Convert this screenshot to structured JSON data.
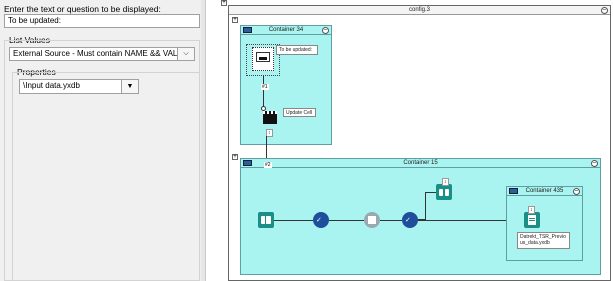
{
  "properties_panel": {
    "question_label": "Enter the text or question to be displayed:",
    "question_value": "To be updated:",
    "list_values_label": "List Values",
    "list_source_value": "External Source - Must contain NAME && VALUE",
    "properties_label": "Properties",
    "file_value": "\\Input data.yxdb"
  },
  "canvas": {
    "outer_container_title": "config.3",
    "container_34": {
      "title": "Container 34",
      "note_question": "To be updated:",
      "connection_label": "#1",
      "note_update": "Update Cell"
    },
    "container_15": {
      "title": "Container 15",
      "connection_label": "#2"
    },
    "container_435": {
      "title": "Container 435",
      "output_note": "Datrekt_TSR_Previous_data.yxdb"
    }
  },
  "colors": {
    "container_fill": "#a9f4f0",
    "tool_blue": "#1f4e9c",
    "tool_teal": "#1a8f86",
    "tool_grey": "#9aa8b0"
  },
  "icons": [
    "chevron-down-icon",
    "container-icon",
    "collapse-icon",
    "book-input-icon",
    "check-tool-icon",
    "tool-icon",
    "binoculars-icon",
    "output-doc-icon",
    "clapper-icon",
    "question-icon"
  ]
}
